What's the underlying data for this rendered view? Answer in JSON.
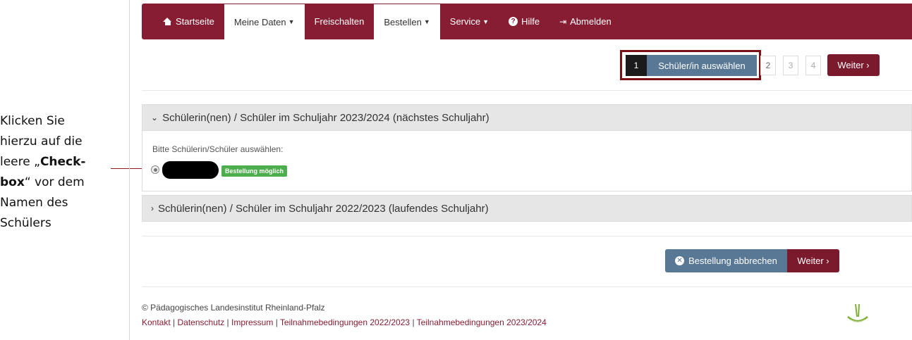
{
  "annotation": {
    "line1": "Klicken Sie",
    "line2": "hierzu auf die",
    "line3_pre": "leere „",
    "line3_bold": "Check-",
    "line4_bold": "box",
    "line4_post": "“ vor dem",
    "line5": "Namen des",
    "line6": "Schülers"
  },
  "navbar": {
    "items": [
      {
        "label": "Startseite",
        "icon": "home-icon"
      },
      {
        "label": "Meine Daten",
        "icon": "caret-down-icon"
      },
      {
        "label": "Freischalten"
      },
      {
        "label": "Bestellen",
        "icon": "caret-down-icon"
      },
      {
        "label": "Service",
        "icon": "caret-down-icon"
      },
      {
        "label": "Hilfe",
        "icon": "question-circle-icon"
      },
      {
        "label": "Abmelden",
        "icon": "logout-icon"
      }
    ]
  },
  "stepper": {
    "current_number": "1",
    "current_label": "Schüler/in auswählen",
    "steps": [
      "2",
      "3",
      "4"
    ],
    "next_label": "Weiter"
  },
  "panels": {
    "next_year": {
      "title": "Schülerin(nen) / Schüler im Schuljahr 2023/2024 (nächstes Schuljahr)",
      "select_label": "Bitte Schülerin/Schüler auswählen:",
      "badge": "Bestellung möglich"
    },
    "current_year": {
      "title": "Schülerin(nen) / Schüler im Schuljahr 2022/2023 (laufendes Schuljahr)"
    }
  },
  "actions": {
    "cancel_label": "Bestellung abbrechen",
    "next_label": "Weiter"
  },
  "footer": {
    "copyright": "© Pädagogisches Landesinstitut Rheinland-Pfalz",
    "links": [
      "Kontakt",
      "Datenschutz",
      "Impressum",
      "Teilnahmebedingungen 2022/2023",
      "Teilnahmebedingungen 2023/2024"
    ]
  },
  "colors": {
    "brand": "#871d33",
    "step_active": "#587896",
    "badge_success": "#4cae4c"
  }
}
